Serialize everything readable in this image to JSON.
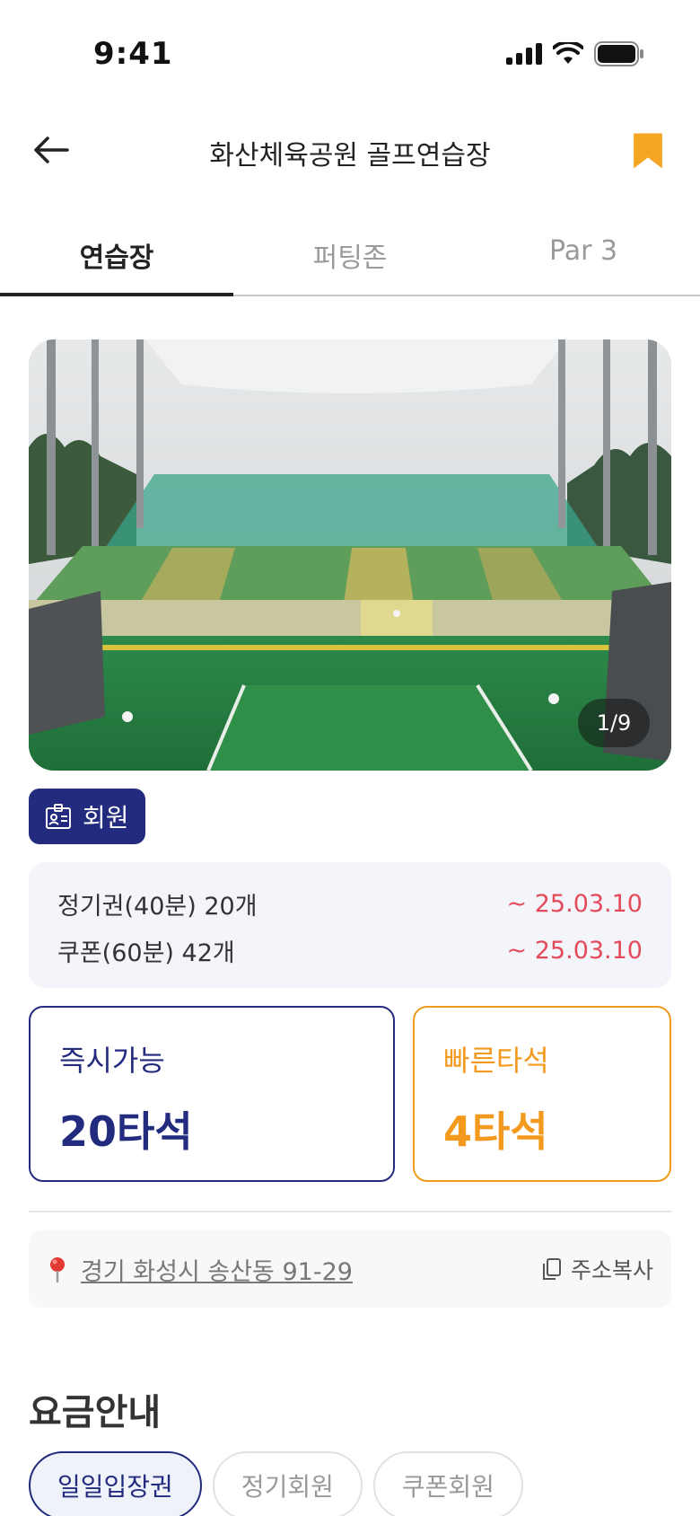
{
  "status_bar": {
    "time": "9:41"
  },
  "header": {
    "title": "화산체육공원 골프연습장"
  },
  "tabs": [
    {
      "label": "연습장",
      "active": true
    },
    {
      "label": "퍼팅존",
      "active": false
    },
    {
      "label": "Par 3",
      "active": false
    }
  ],
  "photo": {
    "counter": "1/9"
  },
  "member_badge": {
    "label": "회원"
  },
  "passes": [
    {
      "name": "정기권(40분) 20개",
      "expiry": "~ 25.03.10"
    },
    {
      "name": "쿠폰(60분) 42개",
      "expiry": "~ 25.03.10"
    }
  ],
  "seats": {
    "instant": {
      "label": "즉시가능",
      "count": "20타석"
    },
    "quick": {
      "label": "빠른타석",
      "count": "4타석"
    }
  },
  "address": {
    "text": "경기 화성시 송산동 91-29",
    "copy_label": "주소복사"
  },
  "fee_section": {
    "title": "요금안내",
    "tabs": [
      {
        "label": "일일입장권",
        "active": true
      },
      {
        "label": "정기회원",
        "active": false
      },
      {
        "label": "쿠폰회원",
        "active": false
      }
    ]
  },
  "colors": {
    "navy": "#222b7d",
    "orange": "#f39a1e",
    "red": "#e34a5a"
  },
  "icons": [
    "signal-icon",
    "wifi-icon",
    "battery-icon",
    "back-arrow-icon",
    "bookmark-icon",
    "member-card-icon",
    "location-pin-icon",
    "copy-icon"
  ]
}
